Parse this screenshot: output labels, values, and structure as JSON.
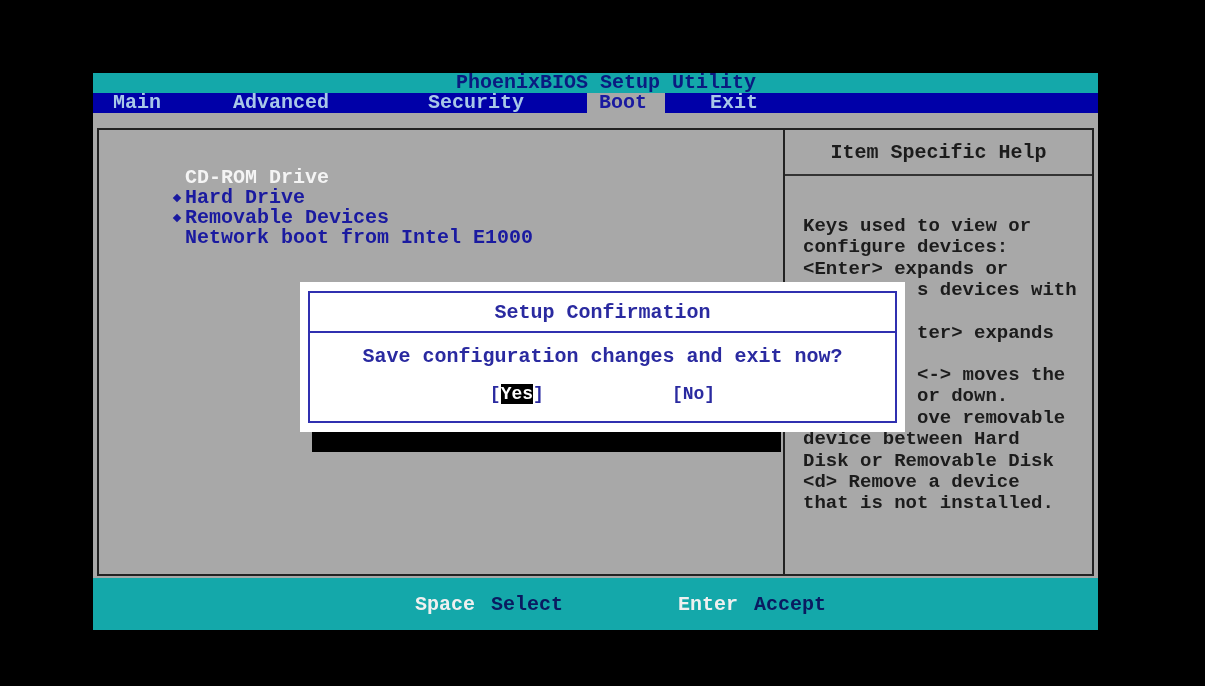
{
  "title": "PhoenixBIOS Setup Utility",
  "tabs": [
    {
      "label": "Main",
      "selected": false
    },
    {
      "label": "Advanced",
      "selected": false
    },
    {
      "label": "Security",
      "selected": false
    },
    {
      "label": "Boot",
      "selected": true
    },
    {
      "label": "Exit",
      "selected": false
    }
  ],
  "boot_items": [
    {
      "label": "CD-ROM Drive",
      "selected": true,
      "expandable": false
    },
    {
      "label": "Hard Drive",
      "selected": false,
      "expandable": true
    },
    {
      "label": "Removable Devices",
      "selected": false,
      "expandable": true
    },
    {
      "label": "Network boot from Intel E1000",
      "selected": false,
      "expandable": false
    }
  ],
  "help": {
    "title": "Item Specific Help",
    "lines": [
      {
        "text": "Keys used to view or",
        "kind": "full"
      },
      {
        "text": "configure devices:",
        "kind": "full"
      },
      {
        "text": "<Enter> expands or",
        "kind": "full"
      },
      {
        "text": "s devices with",
        "kind": "partial"
      },
      {
        "kind": "blank"
      },
      {
        "text": "ter> expands",
        "kind": "partial"
      },
      {
        "kind": "blank"
      },
      {
        "text": "<-> moves the",
        "kind": "partial"
      },
      {
        "text": "or down.",
        "kind": "partial"
      },
      {
        "text": "ove removable",
        "kind": "partial"
      },
      {
        "text": "device between Hard",
        "kind": "full"
      },
      {
        "text": "Disk or Removable Disk",
        "kind": "full"
      },
      {
        "text": "<d> Remove a device",
        "kind": "full"
      },
      {
        "text": "that is not installed.",
        "kind": "full"
      }
    ]
  },
  "dialog": {
    "title": "Setup Confirmation",
    "message": "Save configuration changes and exit now?",
    "buttons": [
      {
        "label": "[Yes]",
        "selected": true
      },
      {
        "label": "[No]",
        "selected": false
      }
    ]
  },
  "status_bar": [
    {
      "key": "Space",
      "action": "Select"
    },
    {
      "key": "Enter",
      "action": "Accept"
    }
  ]
}
